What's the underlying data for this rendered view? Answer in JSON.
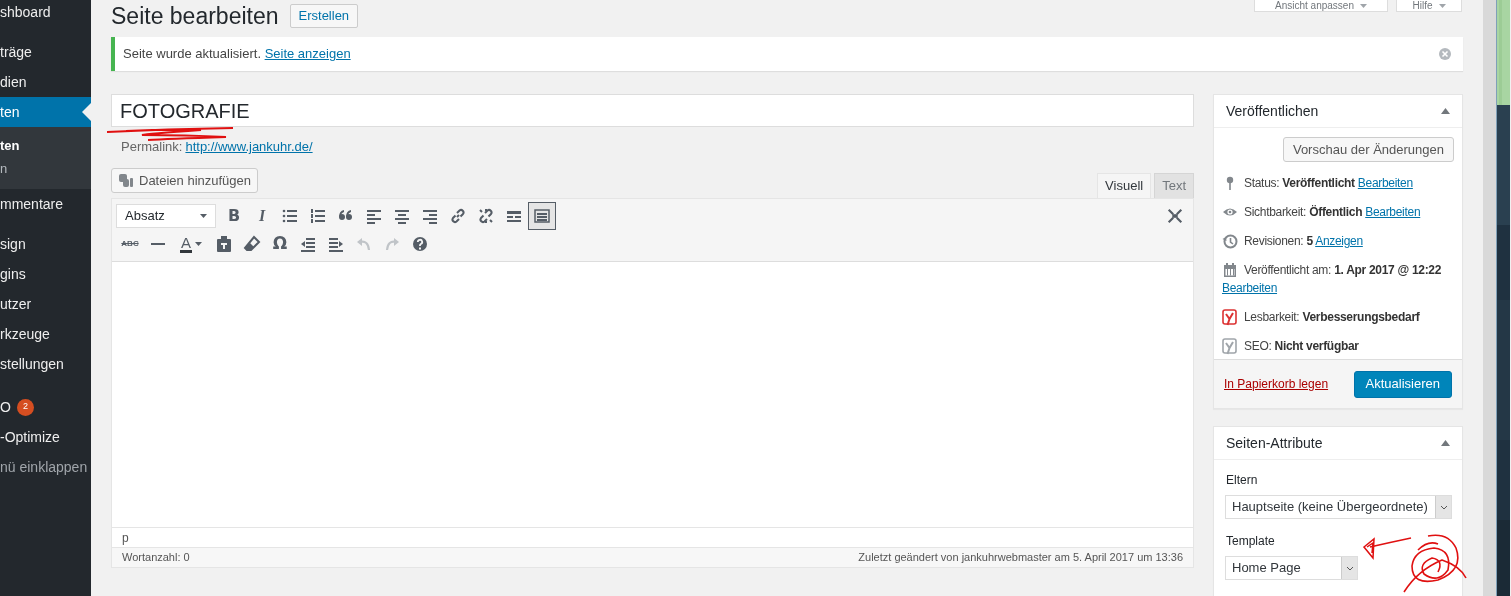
{
  "top_buttons": [
    {
      "label": "Ansicht anpassen"
    },
    {
      "label": "Hilfe"
    }
  ],
  "menu": [
    [
      {
        "label": "shboard",
        "selected": false
      }
    ],
    [
      {
        "label": "träge",
        "selected": false
      },
      {
        "label": "dien",
        "selected": false
      },
      {
        "label": "ten",
        "selected": true,
        "children": [
          {
            "label": "ten",
            "selected": true
          },
          {
            "label": "n",
            "selected": false
          }
        ]
      },
      {
        "label": "mmentare",
        "selected": false
      }
    ],
    [
      {
        "label": "sign",
        "selected": false
      },
      {
        "label": "gins",
        "selected": false
      },
      {
        "label": "utzer",
        "selected": false
      },
      {
        "label": "rkzeuge",
        "selected": false
      },
      {
        "label": "stellungen",
        "selected": false
      }
    ],
    [
      {
        "label": "O",
        "selected": false,
        "badge": "2"
      },
      {
        "label": "-Optimize",
        "selected": false
      },
      {
        "label": "nü einklappen",
        "selected": false,
        "kind": "collapse"
      }
    ]
  ],
  "heading": {
    "title": "Seite bearbeiten",
    "action": "Erstellen"
  },
  "notice": {
    "text": "Seite wurde aktualisiert.",
    "link": "Seite anzeigen"
  },
  "post_title": "FOTOGRAFIE",
  "permalink": {
    "label": "Permalink:",
    "url": "http://www.jankuhr.de/"
  },
  "media_button": "Dateien hinzufügen",
  "editor_tabs": [
    {
      "label": "Visuell",
      "selected": true
    },
    {
      "label": "Text",
      "selected": false
    }
  ],
  "toolbar": {
    "format": "Absatz",
    "bold": "B",
    "italic": "I",
    "strikethrough": "ABC",
    "text_color": "A",
    "special_char": "Ω",
    "toggle_pressed": true,
    "undo_disabled": true,
    "redo_disabled": true
  },
  "editor_path": "p",
  "word_count": "Wortanzahl: 0",
  "last_modified": "Zuletzt geändert von jankuhrwebmaster am 5. April 2017 um 13:36",
  "publish": {
    "title": "Veröffentlichen",
    "preview": "Vorschau der Änderungen",
    "rows": [
      {
        "kind": "pin",
        "label": "Status:",
        "value": "Veröffentlicht",
        "link": "Bearbeiten"
      },
      {
        "kind": "eye",
        "label": "Sichtbarkeit:",
        "value": "Öffentlich",
        "link": "Bearbeiten"
      },
      {
        "kind": "history",
        "label": "Revisionen:",
        "value": "5",
        "link": "Anzeigen"
      },
      {
        "kind": "calendar",
        "label": "Veröffentlicht am:",
        "value": "1. Apr 2017 @ 12:22",
        "link": "Bearbeiten"
      },
      {
        "kind": "yoast",
        "color": "#dc3232",
        "label": "Lesbarkeit:",
        "value": "Verbesserungsbedarf"
      },
      {
        "kind": "yoast",
        "color": "#a0a5aa",
        "label": "SEO:",
        "value": "Nicht verfügbar"
      }
    ],
    "trash": "In Papierkorb legen",
    "update": "Aktualisieren"
  },
  "attributes": {
    "title": "Seiten-Attribute",
    "parent_label": "Eltern",
    "parent_value": "Hauptseite (keine Übergeordnete)",
    "template_label": "Template",
    "template_value": "Home Page"
  }
}
